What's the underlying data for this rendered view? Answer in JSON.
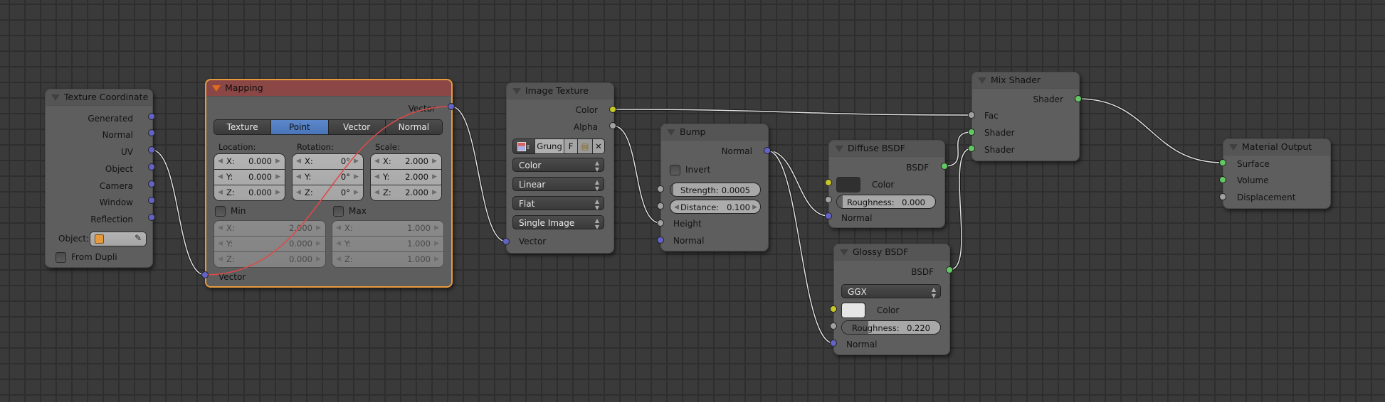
{
  "editor": "Node Editor",
  "nodes": {
    "texture_coordinate": {
      "title": "Texture Coordinate",
      "outputs": [
        "Generated",
        "Normal",
        "UV",
        "Object",
        "Camera",
        "Window",
        "Reflection"
      ],
      "object_label": "Object:",
      "object_value": "",
      "from_dupli_label": "From Dupli",
      "from_dupli_checked": false
    },
    "mapping": {
      "title": "Mapping",
      "output": "Vector",
      "input": "Vector",
      "types": [
        "Texture",
        "Point",
        "Vector",
        "Normal"
      ],
      "selected_type": "Point",
      "location": {
        "label": "Location:",
        "x": "0.000",
        "y": "0.000",
        "z": "0.000"
      },
      "rotation": {
        "label": "Rotation:",
        "x": "0°",
        "y": "0°",
        "z": "0°"
      },
      "scale": {
        "label": "Scale:",
        "x": "2.000",
        "y": "2.000",
        "z": "2.000"
      },
      "min": {
        "label": "Min",
        "checked": false,
        "x": "2.000",
        "y": "0.000",
        "z": "0.000"
      },
      "max": {
        "label": "Max",
        "checked": false,
        "x": "1.000",
        "y": "1.000",
        "z": "1.000"
      },
      "axis_labels": {
        "x": "X:",
        "y": "Y:",
        "z": "Z:"
      }
    },
    "image_texture": {
      "title": "Image Texture",
      "outputs": [
        "Color",
        "Alpha"
      ],
      "image_name": "Grung",
      "fake_user": "F",
      "color_space": "Color",
      "interpolation": "Linear",
      "projection": "Flat",
      "source": "Single Image",
      "input": "Vector"
    },
    "bump": {
      "title": "Bump",
      "output": "Normal",
      "invert_label": "Invert",
      "invert_checked": false,
      "strength_label": "Strength:",
      "strength_value": "0.0005",
      "strength_fraction": 0.0005,
      "distance_label": "Distance:",
      "distance_value": "0.100",
      "inputs": [
        "Height",
        "Normal"
      ]
    },
    "diffuse_bsdf": {
      "title": "Diffuse BSDF",
      "output": "BSDF",
      "color_label": "Color",
      "color_value": "#303030",
      "roughness_label": "Roughness:",
      "roughness_value": "0.000",
      "roughness_fraction": 0.0,
      "normal_label": "Normal"
    },
    "glossy_bsdf": {
      "title": "Glossy BSDF",
      "output": "BSDF",
      "distribution": "GGX",
      "color_label": "Color",
      "color_value": "#e6e6e6",
      "roughness_label": "Roughness:",
      "roughness_value": "0.220",
      "roughness_fraction": 0.22,
      "normal_label": "Normal"
    },
    "mix_shader": {
      "title": "Mix Shader",
      "output": "Shader",
      "inputs": [
        "Fac",
        "Shader",
        "Shader"
      ]
    },
    "material_output": {
      "title": "Material Output",
      "inputs": [
        "Surface",
        "Volume",
        "Displacement"
      ]
    }
  },
  "colors": {
    "vector_socket": "#6363c7",
    "color_socket": "#c7c729",
    "float_socket": "#a1a1a1",
    "shader_socket": "#63c763",
    "active_node_border": "#e79a3c",
    "selected_button": "#4f7bbf",
    "link": "#e0e0e0",
    "active_link": "#e04848"
  }
}
